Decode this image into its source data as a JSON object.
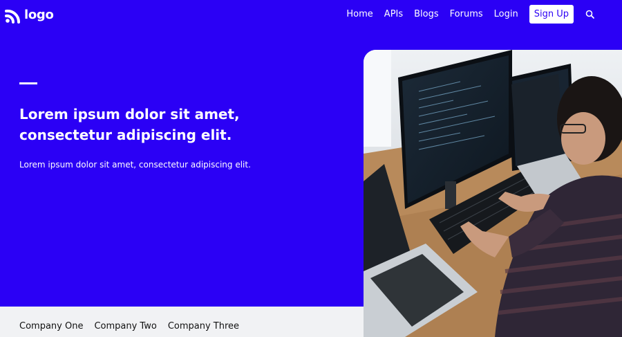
{
  "header": {
    "logo_text": "logo",
    "nav": [
      "Home",
      "APIs",
      "Blogs",
      "Forums",
      "Login"
    ],
    "signup_label": "Sign Up"
  },
  "hero": {
    "title_line1": "Lorem ipsum dolor sit amet,",
    "title_line2": "consectetur adipiscing elit.",
    "subtitle": "Lorem ipsum dolor sit amet, consectetur adipiscing elit."
  },
  "companies": [
    "Company One",
    "Company Two",
    "Company Three"
  ],
  "colors": {
    "brand": "#2b00f5",
    "footer_bg": "#f1f2f4"
  },
  "icons": {
    "logo": "wifi-arcs-icon",
    "search": "search-icon"
  }
}
